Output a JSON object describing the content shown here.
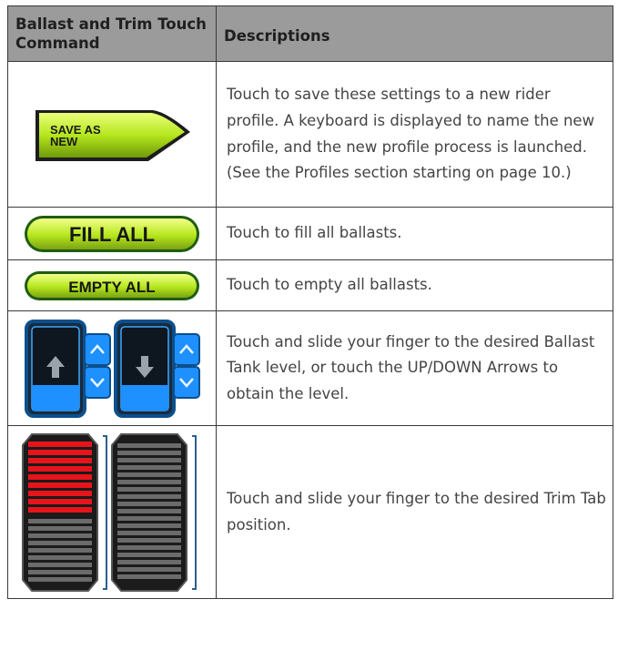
{
  "table": {
    "header": {
      "col1": "Ballast and Trim Touch Command",
      "col2": "Descriptions"
    },
    "rows": [
      {
        "button_label_1": "SAVE AS",
        "button_label_2": "NEW",
        "description": "Touch to save these settings to a new rider profile. A keyboard is displayed to name the new profile, and the new profile process is launched. (See the Profiles section starting on page 10.)"
      },
      {
        "button_label": "FILL ALL",
        "description": "Touch to fill all ballasts."
      },
      {
        "button_label": "EMPTY ALL",
        "description": "Touch to empty all ballasts."
      },
      {
        "icon": "ballast-tank-level-slider-icon",
        "description": "Touch and slide your finger to the desired Ballast Tank level, or touch the UP/DOWN Arrows to obtain the level."
      },
      {
        "icon": "trim-tab-position-slider-icon",
        "description": "Touch and slide your finger to the desired Trim Tab position."
      }
    ]
  },
  "colors": {
    "header_bg": "#9b9b9b",
    "button_green": "#b5e61d",
    "ballast_blue": "#1e90ff",
    "trim_red": "#e8141b"
  }
}
